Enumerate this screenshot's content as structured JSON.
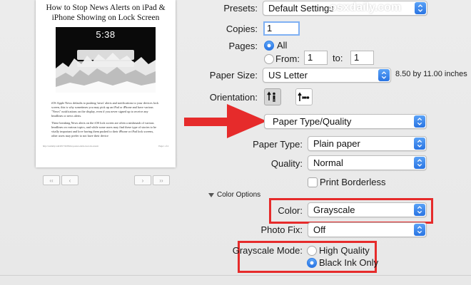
{
  "preview": {
    "title_line1": "How to Stop News Alerts on iPad &",
    "title_line2": "iPhone Showing on Lock Screen",
    "screenshot_time": "5:38",
    "para1": "iOS Apple News defaults to pushing 'news' alerts and notifications to your devices lock screen, this is why sometimes you may pick up an iPad or iPhone and have various \"News\" notifications on the display, even if you never signed up to receive any headlines or news alerts.",
    "para2": "These breaking News alerts on the iOS lock screen are often a mishmash of various headlines on various topics, and while some users may find these type of stories to be vitally important and love having them pushed to their iPhone or iPad lock screens, other users may prefer to not have their device",
    "footer_left": "http://osxdaily.com/2017/02/06/stop-news-alerts-ios-lock-screen/",
    "footer_right": "Page 1 of 4",
    "nav_first": "‹‹",
    "nav_prev": "‹",
    "nav_next": "›",
    "nav_last": "››"
  },
  "watermark": "osxdaily.com",
  "presets": {
    "label": "Presets:",
    "value": "Default Settings"
  },
  "copies": {
    "label": "Copies:",
    "value": "1"
  },
  "pages": {
    "label": "Pages:",
    "all_label": "All",
    "from_label": "From:",
    "from_value": "1",
    "to_label": "to:",
    "to_value": "1",
    "selected": "All"
  },
  "paper_size": {
    "label": "Paper Size:",
    "value": "US Letter",
    "dimensions": "8.50 by 11.00 inches"
  },
  "orientation": {
    "label": "Orientation:",
    "selected": "portrait"
  },
  "section_popup": {
    "value": "Paper Type/Quality"
  },
  "paper_type": {
    "label": "Paper Type:",
    "value": "Plain paper"
  },
  "quality": {
    "label": "Quality:",
    "value": "Normal"
  },
  "print_borderless": {
    "label": "Print Borderless",
    "checked": false
  },
  "color_options": {
    "label": "Color Options",
    "expanded": true
  },
  "color": {
    "label": "Color:",
    "value": "Grayscale"
  },
  "photo_fix": {
    "label": "Photo Fix:",
    "value": "Off"
  },
  "grayscale_mode": {
    "label": "Grayscale Mode:",
    "options": [
      "High Quality",
      "Black Ink Only"
    ],
    "selected": "Black Ink Only"
  },
  "colors": {
    "accent": "#2a74e2",
    "annotation_red": "#e62b2b",
    "watermark": "#ffffff"
  }
}
